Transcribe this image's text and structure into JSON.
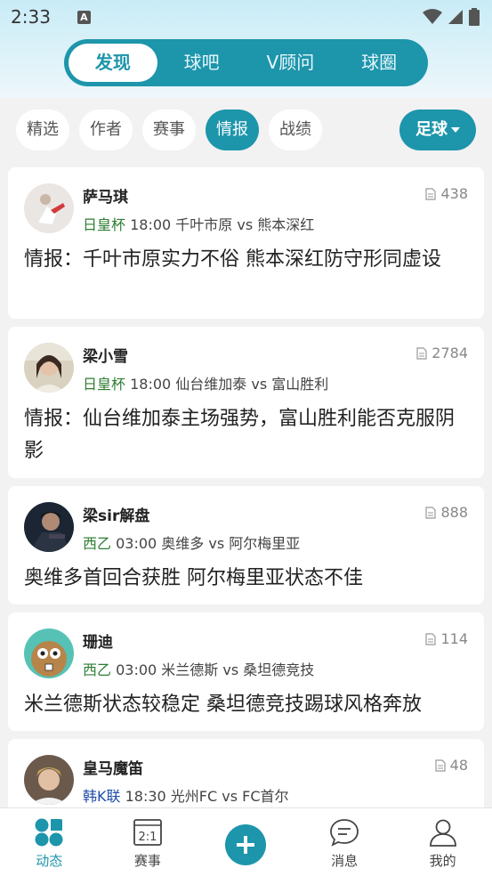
{
  "status": {
    "time": "2:33",
    "a_badge": "A"
  },
  "top_tabs": [
    {
      "label": "发现",
      "active": true
    },
    {
      "label": "球吧",
      "active": false
    },
    {
      "label": "V顾问",
      "active": false
    },
    {
      "label": "球圈",
      "active": false
    }
  ],
  "filters": [
    {
      "label": "精选",
      "active": false
    },
    {
      "label": "作者",
      "active": false
    },
    {
      "label": "赛事",
      "active": false
    },
    {
      "label": "情报",
      "active": true
    },
    {
      "label": "战绩",
      "active": false
    }
  ],
  "sport_button": "足球",
  "posts": [
    {
      "author": "萨马琪",
      "views": "438",
      "league": "日皇杯",
      "league_color": "#2e7d32",
      "match": "18:00 千叶市原 vs 熊本深红",
      "title": "情报：千叶市原实力不俗 熊本深红防守形同虚设"
    },
    {
      "author": "梁小雪",
      "views": "2784",
      "league": "日皇杯",
      "league_color": "#2e7d32",
      "match": "18:00 仙台维加泰 vs 富山胜利",
      "title": "情报：仙台维加泰主场强势，富山胜利能否克服阴影"
    },
    {
      "author": "梁sir解盘",
      "views": "888",
      "league": "西乙",
      "league_color": "#2e7d32",
      "match": "03:00 奥维多 vs 阿尔梅里亚",
      "title": "奥维多首回合获胜 阿尔梅里亚状态不佳"
    },
    {
      "author": "珊迪",
      "views": "114",
      "league": "西乙",
      "league_color": "#2e7d32",
      "match": "03:00 米兰德斯 vs 桑坦德竞技",
      "title": "米兰德斯状态较稳定 桑坦德竞技踢球风格奔放"
    },
    {
      "author": "皇马魔笛",
      "views": "48",
      "league": "韩K联",
      "league_color": "#1e4da8",
      "match": "18:30 光州FC vs FC首尔",
      "title": ""
    }
  ],
  "tabbar": [
    {
      "label": "动态",
      "icon": "dynamic-icon",
      "active": true
    },
    {
      "label": "赛事",
      "icon": "scoreboard-icon",
      "active": false,
      "icon_text": "2:1"
    },
    {
      "label": "",
      "icon": "plus-icon",
      "active": false
    },
    {
      "label": "消息",
      "icon": "message-icon",
      "active": false
    },
    {
      "label": "我的",
      "icon": "profile-icon",
      "active": false
    }
  ]
}
